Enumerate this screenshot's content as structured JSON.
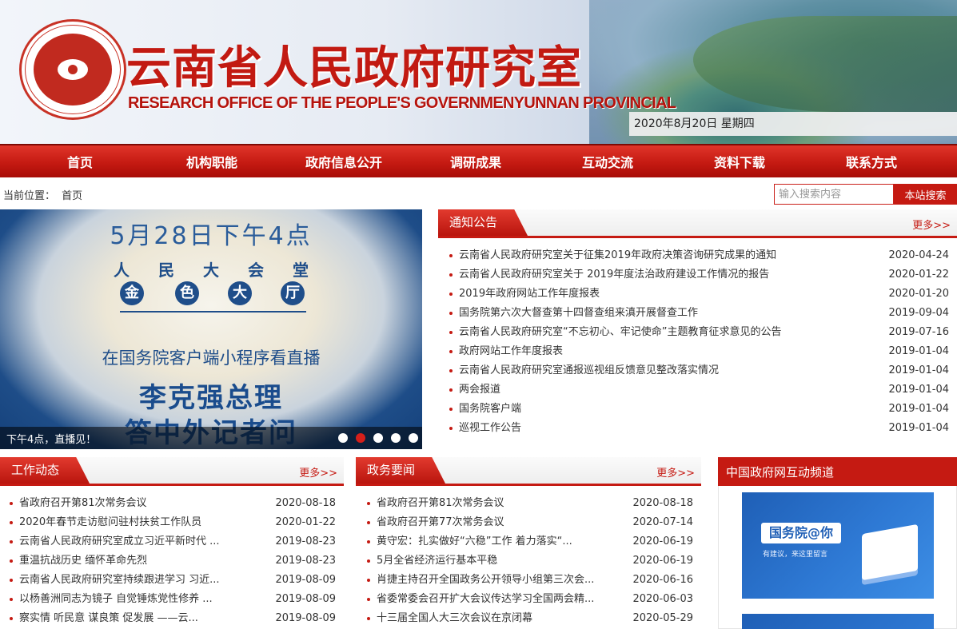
{
  "header": {
    "title": "云南省人民政府研究室",
    "subtitle": "RESEARCH OFFICE OF THE PEOPLE'S GOVERNMENYUNNAN PROVINCIAL",
    "date": "2020年8月20日 星期四",
    "seal_text": "云南省人民政府研究室"
  },
  "nav": [
    "首页",
    "机构职能",
    "政府信息公开",
    "调研成果",
    "互动交流",
    "资料下载",
    "联系方式"
  ],
  "breadcrumb": {
    "label": "当前位置：",
    "current": "首页"
  },
  "search": {
    "placeholder": "输入搜索内容",
    "button": "本站搜索"
  },
  "slider": {
    "date_line": "5月28日下午4点",
    "hall": "人民大会堂",
    "golden_hall": [
      "金",
      "色",
      "大",
      "厅"
    ],
    "app_line": "在国务院客户端小程序看直播",
    "big1": "李克强总理",
    "big2": "答中外记者问",
    "caption": "下午4点，直播见！",
    "active_dot": 2,
    "dot_count": 5
  },
  "notices": {
    "title": "通知公告",
    "more": "更多>>",
    "items": [
      {
        "title": "云南省人民政府研究室关于征集2019年政府决策咨询研究成果的通知",
        "date": "2020-04-24"
      },
      {
        "title": "云南省人民政府研究室关于 2019年度法治政府建设工作情况的报告",
        "date": "2020-01-22"
      },
      {
        "title": "2019年政府网站工作年度报表",
        "date": "2020-01-20"
      },
      {
        "title": "国务院第六次大督查第十四督查组来滇开展督查工作",
        "date": "2019-09-04"
      },
      {
        "title": "云南省人民政府研究室“不忘初心、牢记使命”主题教育征求意见的公告",
        "date": "2019-07-16"
      },
      {
        "title": "政府网站工作年度报表",
        "date": "2019-01-04"
      },
      {
        "title": "云南省人民政府研究室通报巡视组反馈意见整改落实情况",
        "date": "2019-01-04"
      },
      {
        "title": "两会报道",
        "date": "2019-01-04"
      },
      {
        "title": "国务院客户端",
        "date": "2019-01-04"
      },
      {
        "title": "巡视工作公告",
        "date": "2019-01-04"
      }
    ]
  },
  "work_news": {
    "title": "工作动态",
    "more": "更多>>",
    "items": [
      {
        "title": "省政府召开第81次常务会议",
        "date": "2020-08-18"
      },
      {
        "title": "2020年春节走访慰问驻村扶贫工作队员",
        "date": "2020-01-22"
      },
      {
        "title": "云南省人民政府研究室成立习近平新时代 ...",
        "date": "2019-08-23"
      },
      {
        "title": "重温抗战历史  缅怀革命先烈",
        "date": "2019-08-23"
      },
      {
        "title": "云南省人民政府研究室持续跟进学习 习近...",
        "date": "2019-08-09"
      },
      {
        "title": "以杨善洲同志为镜子 自觉锤炼党性修养 ...",
        "date": "2019-08-09"
      },
      {
        "title": "察实情 听民意 谋良策 促发展 ——云...",
        "date": "2019-08-09"
      }
    ]
  },
  "gov_news": {
    "title": "政务要闻",
    "more": "更多>>",
    "items": [
      {
        "title": "省政府召开第81次常务会议",
        "date": "2020-08-18"
      },
      {
        "title": "省政府召开第77次常务会议",
        "date": "2020-07-14"
      },
      {
        "title": "黄守宏：扎实做好“六稳”工作 着力落实“...",
        "date": "2020-06-19"
      },
      {
        "title": "5月全省经济运行基本平稳",
        "date": "2020-06-19"
      },
      {
        "title": "肖捷主持召开全国政务公开领导小组第三次会...",
        "date": "2020-06-16"
      },
      {
        "title": "省委常委会召开扩大会议传达学习全国两会精...",
        "date": "2020-06-03"
      },
      {
        "title": "十三届全国人大三次会议在京闭幕",
        "date": "2020-05-29"
      }
    ]
  },
  "gov_channel": {
    "title": "中国政府网互动频道",
    "ad_title": "国务院@你",
    "ad_sub": "有建议，来这里留言"
  }
}
